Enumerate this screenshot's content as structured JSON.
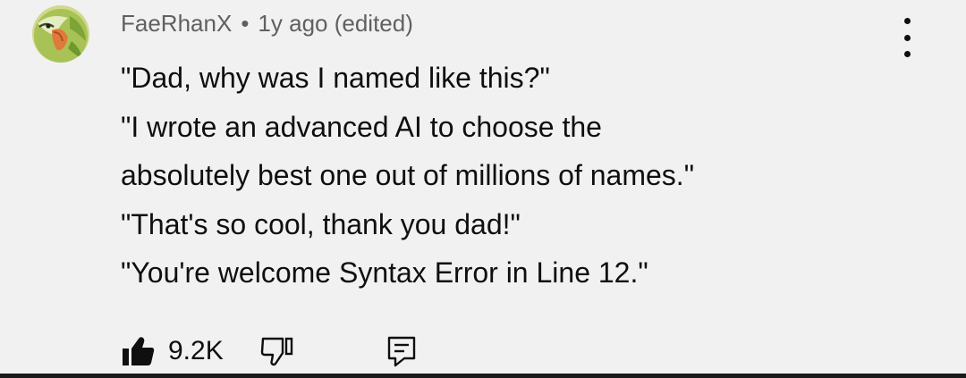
{
  "comment": {
    "author": "FaeRhanX",
    "separator": "•",
    "timestamp": "1y ago (edited)",
    "lines": [
      "\"Dad, why was I named like this?\"",
      "\"I wrote an advanced AI to choose the",
      "absolutely best one out of millions of names.\"",
      "\"That's so cool, thank you dad!\"",
      "\"You're welcome Syntax Error in Line 12.\""
    ],
    "like_count": "9.2K"
  },
  "icons": {
    "avatar": "parrot-avatar-icon",
    "menu": "more-vertical-icon",
    "like": "thumbs-up-filled-icon",
    "dislike": "thumbs-down-outline-icon",
    "reply": "reply-comment-icon"
  },
  "colors": {
    "background": "#f1f1f1",
    "text_primary": "#0f0f0f",
    "text_secondary": "#606060",
    "avatar_green": "#a8c255",
    "avatar_orange": "#e07a3c"
  }
}
